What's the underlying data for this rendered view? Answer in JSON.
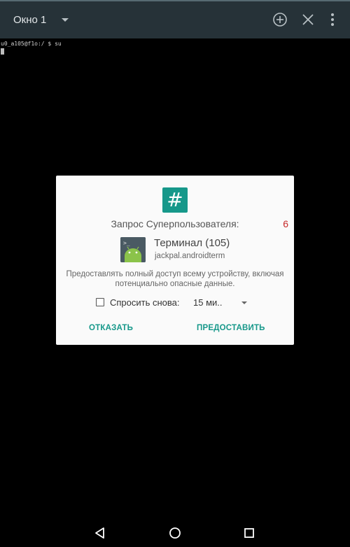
{
  "appbar": {
    "title": "Окно 1",
    "icons": [
      "add-window-icon",
      "close-window-icon",
      "overflow-menu-icon"
    ]
  },
  "terminal": {
    "prompt_line": "u0_a105@f1o:/ $ su"
  },
  "dialog": {
    "request_title": "Запрос Суперпользователя:",
    "countdown": "6",
    "app_name": "Терминал (105)",
    "app_package": "jackpal.androidterm",
    "warning": "Предоставлять полный доступ всему устройству, включая потенциально опасные данные.",
    "remember_label": "Спросить снова:",
    "duration_value": "15 ми..",
    "deny_label": "ОТКАЗАТЬ",
    "grant_label": "ПРЕДОСТАВИТЬ"
  },
  "navbar": {
    "icons": [
      "back-icon",
      "home-icon",
      "recents-icon"
    ]
  },
  "colors": {
    "appbar": "#263238",
    "accent": "#16988a",
    "countdown": "#c62828"
  }
}
